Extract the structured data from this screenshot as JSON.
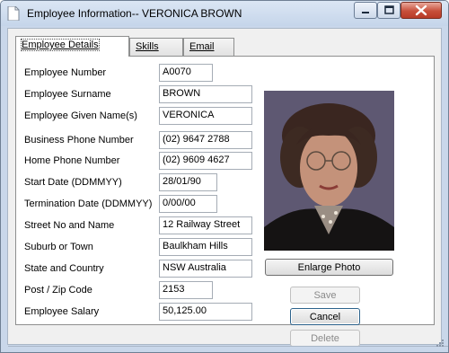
{
  "window": {
    "title": "Employee Information-- VERONICA BROWN",
    "controls": [
      "minimize",
      "maximize",
      "close"
    ]
  },
  "tabs": [
    {
      "label": "Employee Details",
      "active": true
    },
    {
      "label": "Skills",
      "active": false
    },
    {
      "label": "Email",
      "active": false
    }
  ],
  "fields": [
    {
      "label": "Employee Number",
      "value": "A0070"
    },
    {
      "label": "Employee Surname",
      "value": "BROWN"
    },
    {
      "label": "Employee Given Name(s)",
      "value": "VERONICA"
    },
    {
      "label": "Business Phone Number",
      "value": "(02) 9647 2788"
    },
    {
      "label": "Home Phone Number",
      "value": "(02) 9609 4627"
    },
    {
      "label": "Start Date (DDMMYY)",
      "value": "28/01/90"
    },
    {
      "label": "Termination Date (DDMMYY)",
      "value": "0/00/00"
    },
    {
      "label": "Street No and Name",
      "value": "12 Railway Street"
    },
    {
      "label": "Suburb or Town",
      "value": "Baulkham Hills"
    },
    {
      "label": "State and Country",
      "value": "NSW Australia"
    },
    {
      "label": "Post / Zip Code",
      "value": "2153"
    },
    {
      "label": "Employee Salary",
      "value": "50,125.00"
    }
  ],
  "buttons": {
    "enlarge": "Enlarge Photo",
    "save": "Save",
    "cancel": "Cancel",
    "delete": "Delete"
  },
  "colors": {
    "title_bar": "#c5d5ea",
    "close_button": "#c74f3a",
    "photo_background": "#5e5872"
  }
}
